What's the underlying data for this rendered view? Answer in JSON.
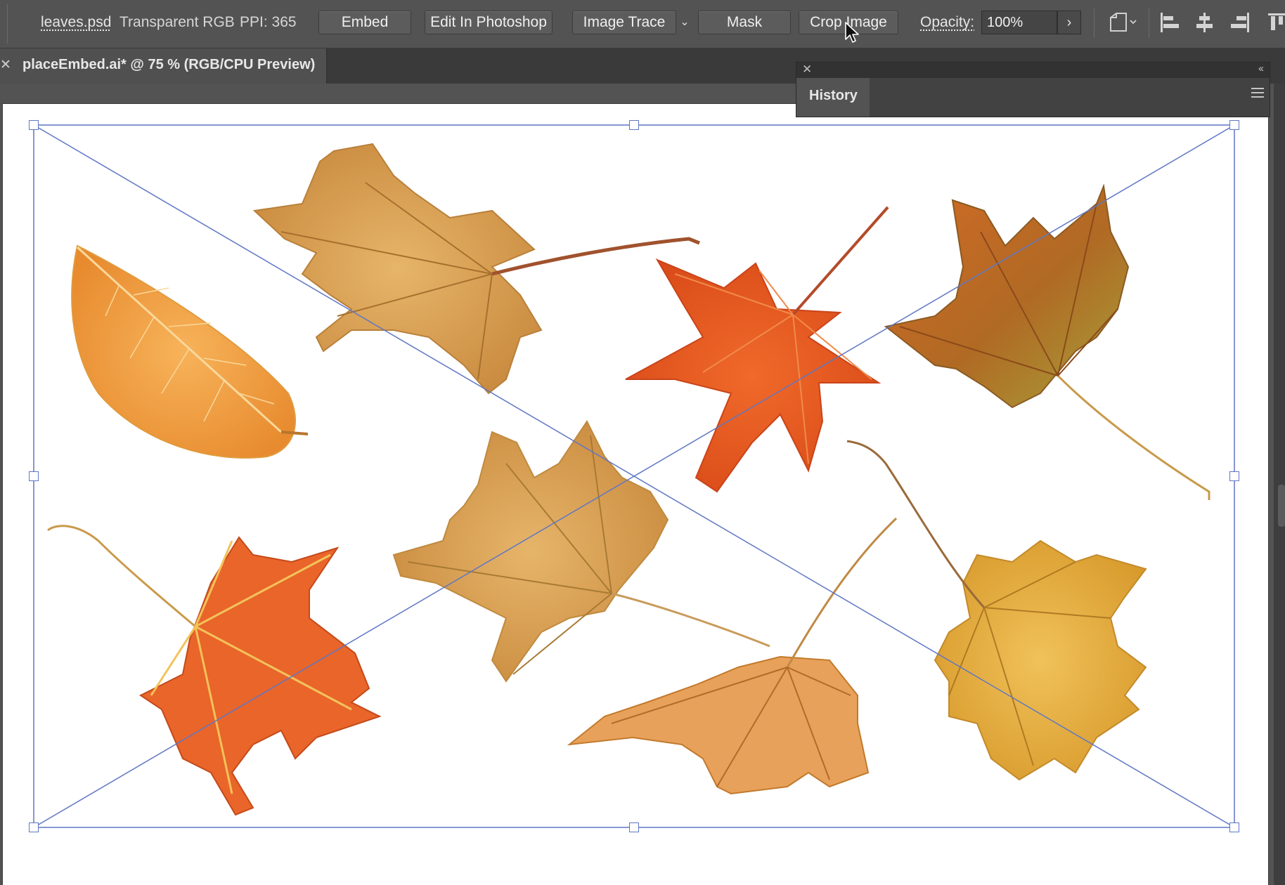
{
  "control_bar": {
    "file_name": "leaves.psd",
    "color_mode": "Transparent RGB",
    "ppi": "PPI: 365",
    "buttons": {
      "embed": "Embed",
      "edit_in_photoshop": "Edit In Photoshop",
      "image_trace": "Image Trace",
      "mask": "Mask",
      "crop_image": "Crop Image"
    },
    "opacity_label": "Opacity:",
    "opacity_value": "100%"
  },
  "document_tab": {
    "title": "placeEmbed.ai* @ 75 % (RGB/CPU Preview)"
  },
  "history_panel": {
    "tab_label": "History"
  },
  "colors": {
    "selection": "#5f77c4",
    "ui_background": "#535353",
    "artboard": "#ffffff"
  },
  "icons": [
    "close-icon",
    "chevron-down-icon",
    "chevron-right-icon",
    "artboard-options-icon",
    "align-left-icon",
    "align-center-icon",
    "align-right-icon",
    "align-top-icon",
    "panel-menu-icon",
    "collapse-icon",
    "mouse-pointer-icon"
  ]
}
